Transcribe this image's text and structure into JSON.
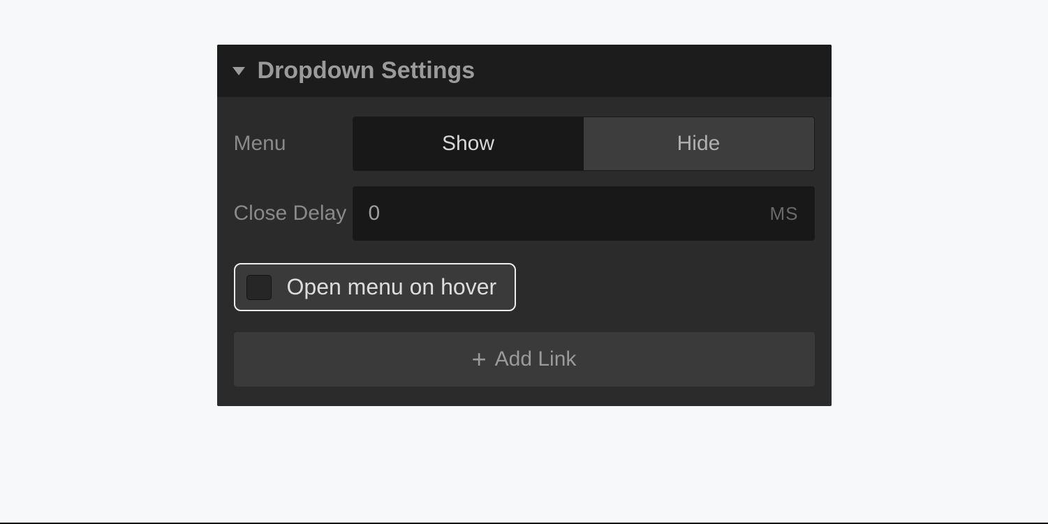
{
  "panel": {
    "title": "Dropdown Settings",
    "menu": {
      "label": "Menu",
      "show": "Show",
      "hide": "Hide"
    },
    "closeDelay": {
      "label": "Close Delay",
      "value": "0",
      "unit": "MS"
    },
    "hoverCheckbox": {
      "label": "Open menu on hover"
    },
    "addLink": {
      "label": "Add Link"
    }
  }
}
